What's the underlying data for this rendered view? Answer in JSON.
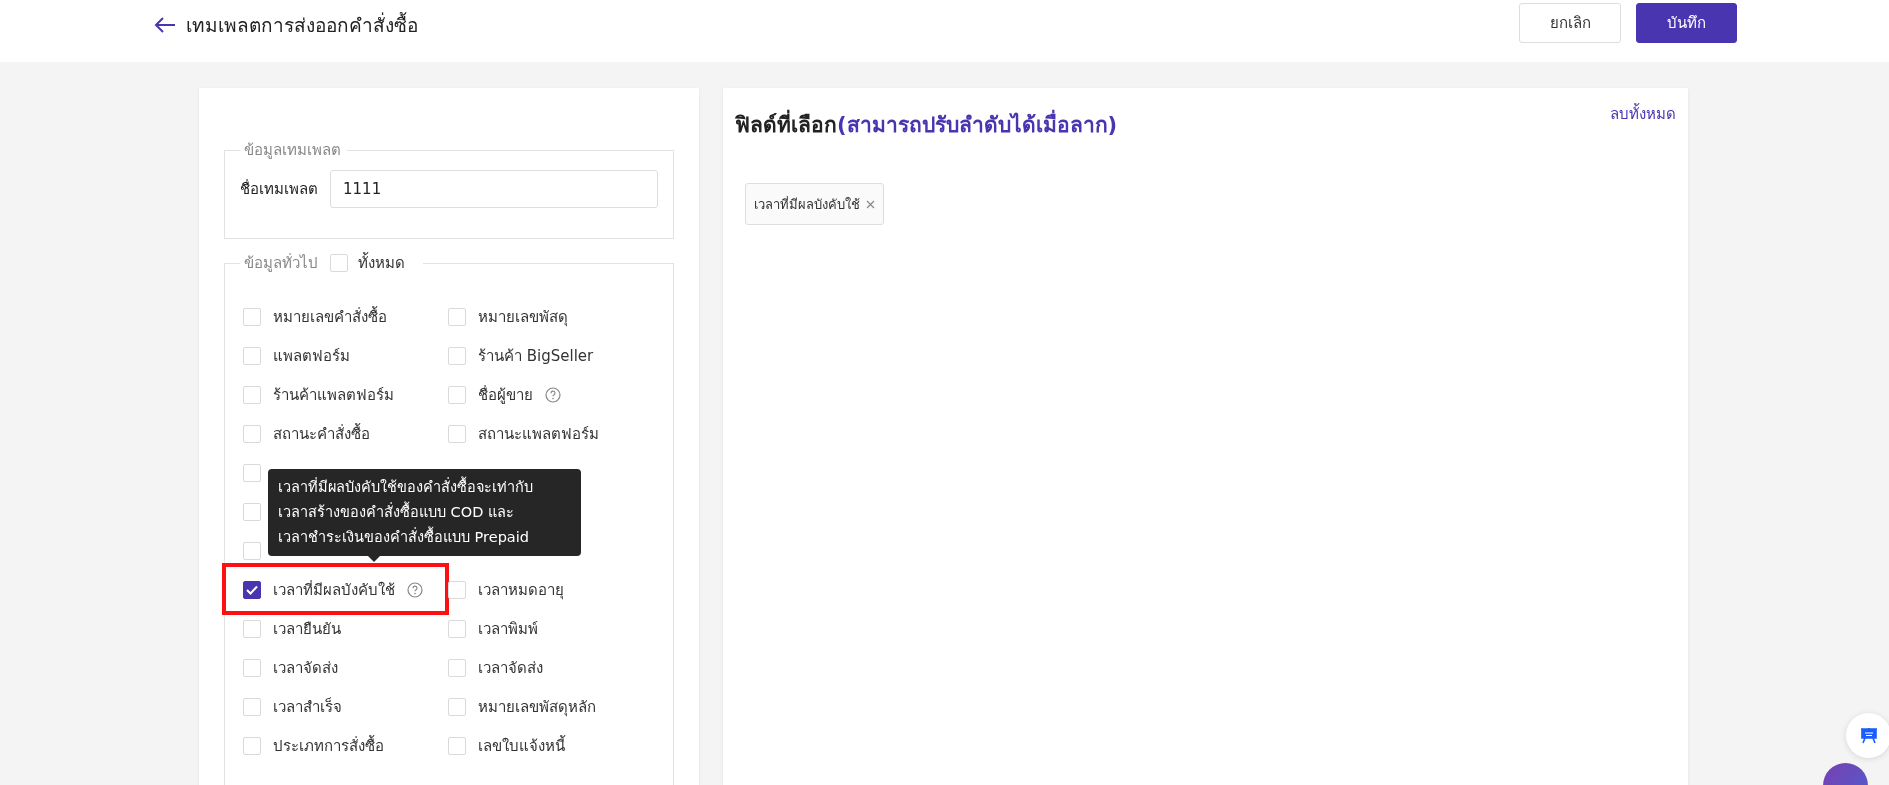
{
  "header": {
    "title": "เทมเพลตการส่งออกคำสั่งซื้อ",
    "buttons": [
      {
        "label": "ยกเลิก",
        "kind": "secondary"
      },
      {
        "label": "บันทึก",
        "kind": "primary"
      }
    ]
  },
  "template_info": {
    "legend": "ข้อมูลเทมเพลต",
    "name_label": "ชื่อเทมเพลต",
    "name_value": "1111"
  },
  "general_info": {
    "legend": "ข้อมูลทั่วไป",
    "select_all": {
      "label": "ทั้งหมด",
      "checked": false
    },
    "rows": [
      {
        "left": {
          "label": "หมายเลขคำสั่งซื้อ",
          "checked": false
        },
        "right": {
          "label": "หมายเลขพัสดุ",
          "checked": false
        }
      },
      {
        "left": {
          "label": "แพลตฟอร์ม",
          "checked": false
        },
        "right": {
          "label": "ร้านค้า BigSeller",
          "checked": false
        }
      },
      {
        "left": {
          "label": "ร้านค้าแพลตฟอร์ม",
          "checked": false
        },
        "right": {
          "label": "ชื่อผู้ขาย",
          "checked": false,
          "help": true
        }
      },
      {
        "left": {
          "label": "สถานะคำสั่งซื้อ",
          "checked": false
        },
        "right": {
          "label": "สถานะแพลตฟอร์ม",
          "checked": false
        }
      },
      {
        "left": {
          "checked": false
        }
      },
      {
        "left": {
          "checked": false
        }
      },
      {
        "left": {
          "checked": false
        }
      },
      {
        "left": {
          "label": "เวลาที่มีผลบังคับใช้",
          "checked": true,
          "help": true,
          "highlighted": true,
          "tooltip": [
            "เวลาที่มีผลบังคับใช้ของคำสั่งซื้อจะเท่ากับ",
            "เวลาสร้างของคำสั่งซื้อแบบ COD และ",
            "เวลาชำระเงินของคำสั่งซื้อแบบ Prepaid"
          ]
        },
        "right": {
          "label": "เวลาหมดอายุ",
          "checked": false
        }
      },
      {
        "left": {
          "label": "เวลายืนยัน",
          "checked": false
        },
        "right": {
          "label": "เวลาพิมพ์",
          "checked": false
        }
      },
      {
        "left": {
          "label": "เวลาจัดส่ง",
          "checked": false
        },
        "right": {
          "label": "เวลาจัดส่ง",
          "checked": false
        }
      },
      {
        "left": {
          "label": "เวลาสำเร็จ",
          "checked": false
        },
        "right": {
          "label": "หมายเลขพัสดุหลัก",
          "checked": false
        }
      },
      {
        "left": {
          "label": "ประเภทการสั่งซื้อ",
          "checked": false
        },
        "right": {
          "label": "เลขใบแจ้งหนี้",
          "checked": false
        }
      }
    ]
  },
  "selected_fields": {
    "title": "ฟิลด์ที่เลือก",
    "hint": "(สามารถปรับลำดับได้เมื่อลาก)",
    "clear_all": "ลบทั้งหมด",
    "tags": [
      {
        "label": "เวลาที่มีผลบังคับใช้"
      }
    ]
  }
}
